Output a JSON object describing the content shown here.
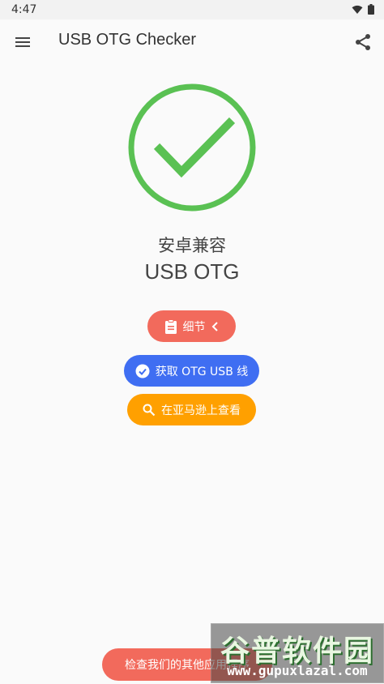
{
  "status_bar": {
    "time": "4:47"
  },
  "app_bar": {
    "title": "USB OTG Checker"
  },
  "result": {
    "line1": "安卓兼容",
    "line2": "USB OTG",
    "check_color": "#5ac153"
  },
  "buttons": {
    "details": "细节",
    "buy": "获取 OTG USB 线",
    "amazon": "在亚马逊上查看",
    "bottom": "检查我们的其他应用程序"
  },
  "watermark": {
    "title": "谷普软件园",
    "url": "www.gupuxlazal.com"
  },
  "colors": {
    "details_bg": "#f26a5c",
    "buy_bg": "#3f6ef2",
    "amazon_bg": "#ffa000"
  }
}
